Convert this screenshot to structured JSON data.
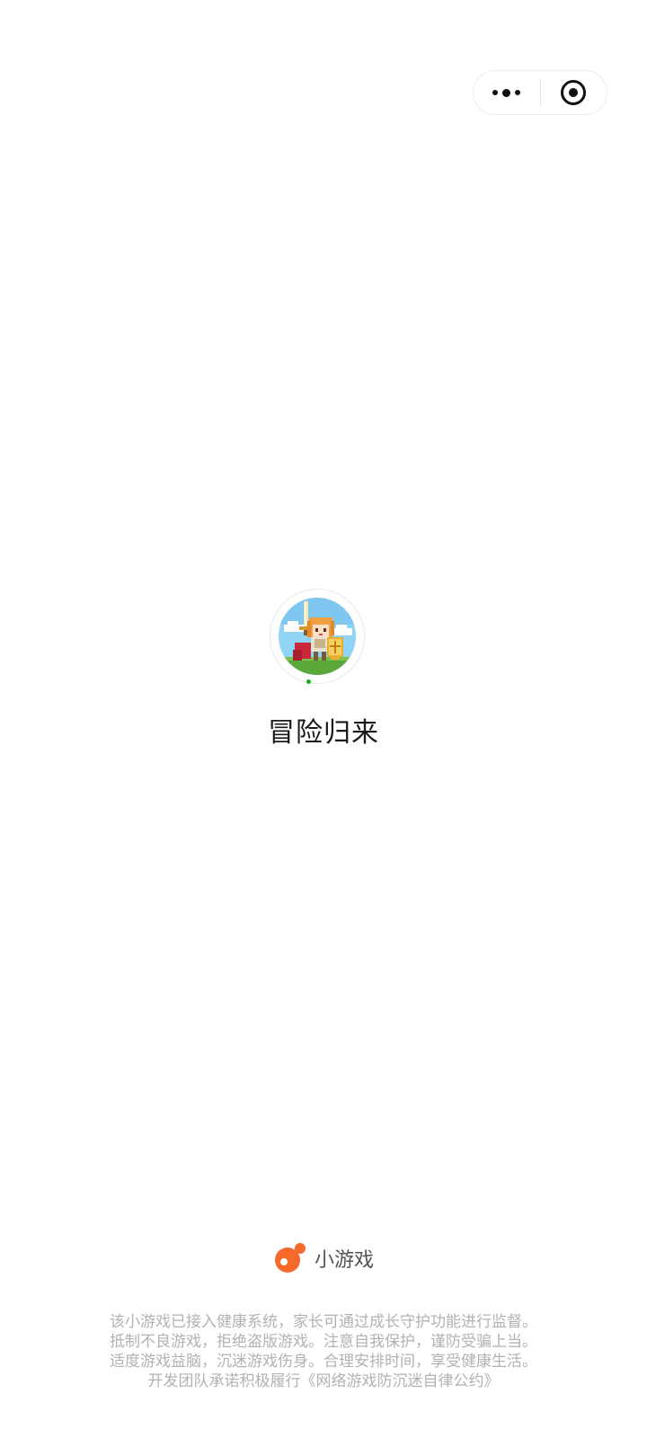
{
  "capsule": {
    "more_icon": "more-dots-icon",
    "close_icon": "target-close-icon"
  },
  "game": {
    "name": "冒险归来",
    "avatar_icon": "pixel-knight-avatar"
  },
  "brand": {
    "label": "小游戏",
    "logo_color": "#F5692B"
  },
  "notice": {
    "lines": [
      "该小游戏已接入健康系统，家长可通过成长守护功能进行监督。",
      "抵制不良游戏，拒绝盗版游戏。注意自我保护，谨防受骗上当。",
      "适度游戏益脑，沉迷游戏伤身。合理安排时间，享受健康生活。",
      "开发团队承诺积极履行《网络游戏防沉迷自律公约》"
    ]
  },
  "colors": {
    "loading_dot": "#1AAD19",
    "notice_text": "#B2B2B2"
  }
}
